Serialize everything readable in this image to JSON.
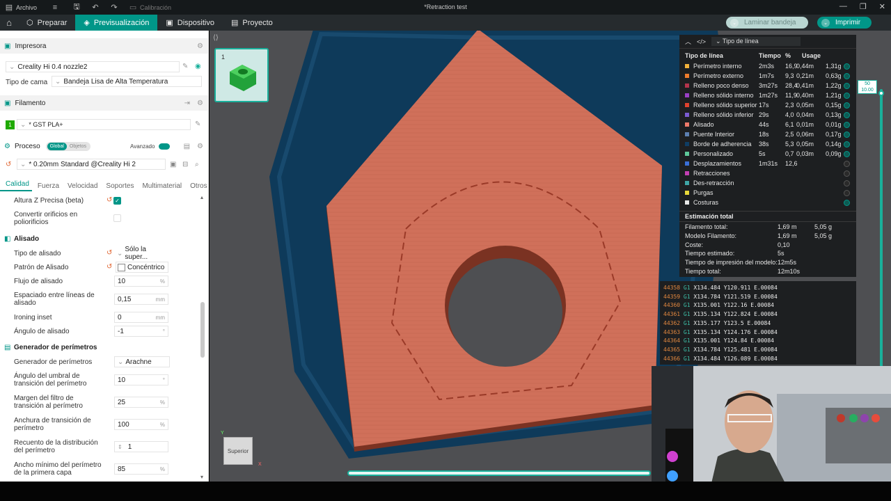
{
  "titlebar": {
    "menu_archivo": "Archivo",
    "calibracion": "Calibración",
    "title": "*Retraction test"
  },
  "nav": {
    "tabs": [
      {
        "label": "Preparar"
      },
      {
        "label": "Previsualización"
      },
      {
        "label": "Dispositivo"
      },
      {
        "label": "Proyecto"
      }
    ],
    "slice_button": "Laminar bandeja",
    "print_button": "Imprimir"
  },
  "left": {
    "printer_section": "Impresora",
    "printer_value": "Creality Hi 0.4 nozzle2",
    "bed_label": "Tipo de cama",
    "bed_value": "Bandeja Lisa de Alta Temperatura",
    "filament_section": "Filamento",
    "filament_index": "1",
    "filament_value": "* GST PLA+",
    "process_section": "Proceso",
    "process_global": "Global",
    "process_objects": "Objetos",
    "process_advanced": "Avanzado",
    "process_value": "* 0.20mm Standard @Creality Hi 2",
    "tabs": [
      "Calidad",
      "Fuerza",
      "Velocidad",
      "Soportes",
      "Multimaterial",
      "Otros"
    ],
    "settings": {
      "altura_z": "Altura Z Precisa (beta)",
      "convertir": "Convertir orificios en poliorificios",
      "alisado_group": "Alisado",
      "tipo_alisado": "Tipo de alisado",
      "tipo_alisado_val": "Sólo la super...",
      "patron_alisado": "Patrón de Alisado",
      "patron_alisado_val": "Concéntrico",
      "flujo": "Flujo de alisado",
      "flujo_val": "10",
      "flujo_unit": "%",
      "espaciado": "Espaciado entre líneas de alisado",
      "espaciado_val": "0,15",
      "espaciado_unit": "mm",
      "inset": "Ironing inset",
      "inset_val": "0",
      "inset_unit": "mm",
      "angulo": "Ángulo de alisado",
      "angulo_val": "-1",
      "angulo_unit": "°",
      "perimetros_group": "Generador de perímetros",
      "generador": "Generador de perímetros",
      "generador_val": "Arachne",
      "umbral": "Ángulo del umbral de transición del perímetro",
      "umbral_val": "10",
      "umbral_unit": "°",
      "margen": "Margen del filtro de transición al perímetro",
      "margen_val": "25",
      "margen_unit": "%",
      "anchura": "Anchura de transición de perímetro",
      "anchura_val": "100",
      "anchura_unit": "%",
      "recuento": "Recuento de la distribución del perímetro",
      "recuento_val": "1",
      "ancho_min": "Ancho mínimo del perímetro de la primera capa",
      "ancho_min_val": "85",
      "ancho_min_unit": "%"
    }
  },
  "plate_number": "1",
  "view_cube": "Superior",
  "layer_top": "50",
  "layer_height": "10.00",
  "line_panel": {
    "selector": "Tipo de línea",
    "cols": {
      "type": "Tipo de línea",
      "time": "Tiempo",
      "pct": "%",
      "usage": "Usage"
    },
    "rows": [
      {
        "name": "Perímetro interno",
        "time": "2m3s",
        "pct": "16,9",
        "m": "0,44m",
        "g": "1,31g",
        "color": "#f4b23a",
        "on": true
      },
      {
        "name": "Perímetro externo",
        "time": "1m7s",
        "pct": "9,3",
        "m": "0,21m",
        "g": "0,63g",
        "color": "#f07c2c",
        "on": true
      },
      {
        "name": "Relleno poco denso",
        "time": "3m27s",
        "pct": "28,4",
        "m": "0,41m",
        "g": "1,22g",
        "color": "#b5344b",
        "on": true
      },
      {
        "name": "Relleno sólido interno",
        "time": "1m27s",
        "pct": "11,9",
        "m": "0,40m",
        "g": "1,21g",
        "color": "#9a3fc4",
        "on": true
      },
      {
        "name": "Relleno sólido superior",
        "time": "17s",
        "pct": "2,3",
        "m": "0,05m",
        "g": "0,15g",
        "color": "#e0422e",
        "on": true
      },
      {
        "name": "Relleno sólido inferior",
        "time": "29s",
        "pct": "4,0",
        "m": "0,04m",
        "g": "0,13g",
        "color": "#7b5bd0",
        "on": true
      },
      {
        "name": "Alisado",
        "time": "44s",
        "pct": "6,1",
        "m": "0,01m",
        "g": "0,01g",
        "color": "#f07a6a",
        "on": true
      },
      {
        "name": "Puente Interior",
        "time": "18s",
        "pct": "2,5",
        "m": "0,06m",
        "g": "0,17g",
        "color": "#5d7fb0",
        "on": true
      },
      {
        "name": "Borde de adherencia",
        "time": "38s",
        "pct": "5,3",
        "m": "0,05m",
        "g": "0,14g",
        "color": "#0f3d63",
        "on": true
      },
      {
        "name": "Personalizado",
        "time": "5s",
        "pct": "0,7",
        "m": "0,03m",
        "g": "0,09g",
        "color": "#5ec99a",
        "on": true
      },
      {
        "name": "Desplazamientos",
        "time": "1m31s",
        "pct": "12,6",
        "m": "",
        "g": "",
        "color": "#3a6fd6",
        "on": false
      },
      {
        "name": "Retracciones",
        "time": "",
        "pct": "",
        "m": "",
        "g": "",
        "color": "#c43fb2",
        "on": false
      },
      {
        "name": "Des-retracción",
        "time": "",
        "pct": "",
        "m": "",
        "g": "",
        "color": "#3fa6a6",
        "on": false
      },
      {
        "name": "Purgas",
        "time": "",
        "pct": "",
        "m": "",
        "g": "",
        "color": "#e8d83a",
        "on": false
      },
      {
        "name": "Costuras",
        "time": "",
        "pct": "",
        "m": "",
        "g": "",
        "color": "#e8e8e8",
        "on": true
      }
    ],
    "estimate_title": "Estimación total",
    "estimates": [
      {
        "k": "Filamento total:",
        "v1": "1,69 m",
        "v2": "5,05 g"
      },
      {
        "k": "Modelo Filamento:",
        "v1": "1,69 m",
        "v2": "5,05 g"
      },
      {
        "k": "Coste:",
        "v1": "0,10",
        "v2": ""
      },
      {
        "k": "Tiempo estimado:",
        "v1": "5s",
        "v2": ""
      },
      {
        "k": "Tiempo de impresión del modelo:",
        "v1": "12m5s",
        "v2": ""
      },
      {
        "k": "Tiempo total:",
        "v1": "12m10s",
        "v2": ""
      }
    ]
  },
  "gcode": [
    {
      "ln": "44358",
      "cmd": "G1",
      "args": "X134.484 Y120.911 E.00084"
    },
    {
      "ln": "44359",
      "cmd": "G1",
      "args": "X134.784 Y121.519 E.00084"
    },
    {
      "ln": "44360",
      "cmd": "G1",
      "args": "X135.001 Y122.16 E.00084"
    },
    {
      "ln": "44361",
      "cmd": "G1",
      "args": "X135.134 Y122.824 E.00084"
    },
    {
      "ln": "44362",
      "cmd": "G1",
      "args": "X135.177 Y123.5 E.00084"
    },
    {
      "ln": "44363",
      "cmd": "G1",
      "args": "X135.134 Y124.176 E.00084"
    },
    {
      "ln": "44364",
      "cmd": "G1",
      "args": "X135.001 Y124.84 E.00084"
    },
    {
      "ln": "44365",
      "cmd": "G1",
      "args": "X134.784 Y125.481 E.00084"
    },
    {
      "ln": "44366",
      "cmd": "G1",
      "args": "X134.484 Y126.089 E.00084"
    }
  ],
  "colors": {
    "accent": "#009688",
    "model": "#d0705a",
    "brim": "#0e3a5a"
  }
}
